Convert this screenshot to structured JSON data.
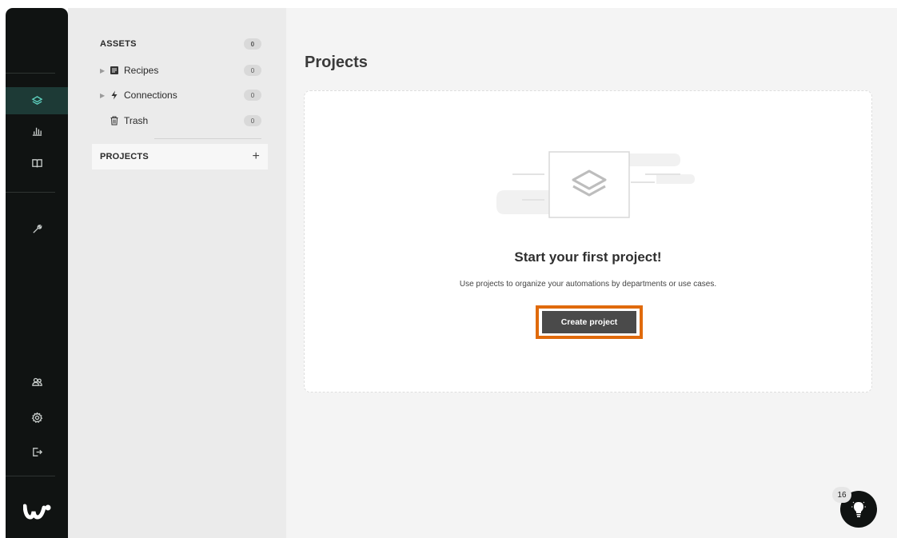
{
  "sidebar": {
    "assets_header": "ASSETS",
    "assets_count": "0",
    "items": [
      {
        "label": "Recipes",
        "count": "0",
        "icon": "recipe-icon"
      },
      {
        "label": "Connections",
        "count": "0",
        "icon": "lightning-icon"
      },
      {
        "label": "Trash",
        "count": "0",
        "icon": "trash-icon"
      }
    ],
    "projects_label": "PROJECTS",
    "add_symbol": "+"
  },
  "rail": {
    "items": [
      {
        "icon": "layers-icon",
        "active": true
      },
      {
        "icon": "bar-chart-icon"
      },
      {
        "icon": "book-icon"
      },
      {
        "icon": "wrench-icon"
      },
      {
        "icon": "users-icon"
      },
      {
        "icon": "gear-icon"
      },
      {
        "icon": "logout-icon"
      }
    ],
    "logo_icon": "workato-logo-icon",
    "accent": "#5fd3c1"
  },
  "main": {
    "title": "Projects",
    "empty_title": "Start your first project!",
    "empty_subtitle": "Use projects to organize your automations by departments or use cases.",
    "cta_label": "Create project",
    "cta_highlight": "#e06a0b"
  },
  "tips": {
    "badge": "16",
    "icon": "lightbulb-icon"
  }
}
